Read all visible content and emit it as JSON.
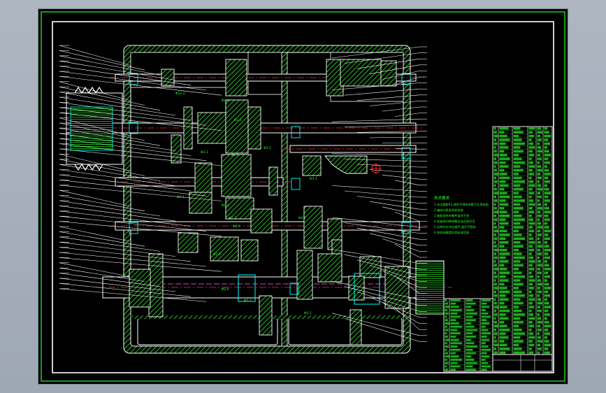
{
  "viewport": {
    "background_color": "#a8b0bc",
    "canvas_color": "#000000"
  },
  "drawing": {
    "frame_color": "#22ff22",
    "line_color": "#ffffff",
    "hatch_color": "#33ee33",
    "centerline_color": "#ff2a2a",
    "dim_color": "#00ffff",
    "accent_color": "#ff66ff",
    "notes_title": "技术要求",
    "notes": [
      "1.未注圆角R2,铸件不得有砂眼气孔等缺陷",
      "2.箱体内表面涂耐油漆",
      "3.装配前所有零件清洗干净",
      "4.各轴承间隙调整适当运转灵活",
      "5.运转时无冲击噪声,温升不超标",
      "6.按机床精度检验标准验收"
    ],
    "gear_labels": [
      "Φ12.2",
      "Φ2.8",
      "Φ3.3",
      "Φ3.5",
      "Φ3.3",
      "Φ2.3",
      "Φ2.2",
      "Φ0.4",
      "Φ0.3",
      "Φ3.4",
      "Φ2.5",
      "Φ2.9",
      "Φ2.6",
      "Φ3.1",
      "Φ4.0",
      "Φ3.2"
    ]
  }
}
